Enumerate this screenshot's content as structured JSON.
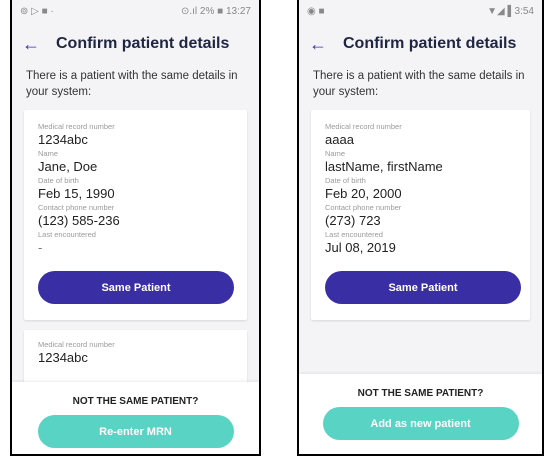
{
  "left": {
    "status": {
      "left_icons": "⊚ ▷ ■ ·",
      "right_text": "⊙.ıl 2% ■ 13:27"
    },
    "header": {
      "back_icon": "←",
      "title": "Confirm patient details"
    },
    "intro": "There is a patient with the same details in your system:",
    "card": {
      "fields": [
        {
          "label": "Medical record number",
          "value": "1234abc"
        },
        {
          "label": "Name",
          "value": "Jane, Doe"
        },
        {
          "label": "Date of birth",
          "value": "Feb 15, 1990"
        },
        {
          "label": "Contact phone number",
          "value": "(123) 585-236"
        },
        {
          "label": "Last encountered",
          "value": "-"
        }
      ],
      "button": "Same Patient"
    },
    "card2": {
      "label": "Medical record number",
      "value": "1234abc"
    },
    "footer": {
      "question": "NOT THE SAME PATIENT?",
      "button": "Re-enter MRN"
    }
  },
  "right": {
    "status": {
      "left_icons": "◉ ■",
      "right_text": "▼◢ ▌3:54"
    },
    "header": {
      "back_icon": "←",
      "title": "Confirm patient details"
    },
    "intro": "There is a patient with the same details in your system:",
    "card": {
      "fields": [
        {
          "label": "Medical record number",
          "value": "aaaa"
        },
        {
          "label": "Name",
          "value": "lastName, firstName"
        },
        {
          "label": "Date of birth",
          "value": "Feb 20, 2000"
        },
        {
          "label": "Contact phone number",
          "value": "(273) 723"
        },
        {
          "label": "Last encountered",
          "value": "Jul 08, 2019"
        }
      ],
      "button": "Same Patient"
    },
    "footer": {
      "question": "NOT THE SAME PATIENT?",
      "button": "Add as new patient"
    }
  },
  "colors": {
    "primary": "#3a2ea5",
    "teal": "#59d3c3",
    "title": "#1f2542"
  }
}
